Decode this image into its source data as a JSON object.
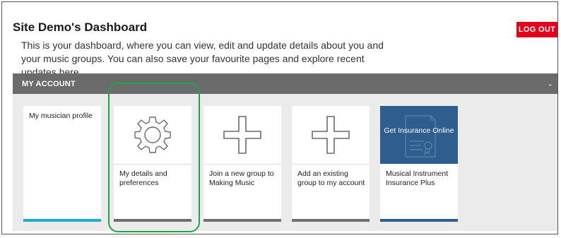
{
  "header": {
    "title": "Site Demo's Dashboard",
    "intro": "This is your dashboard, where you can view, edit and update details about you and your music groups. You can also save your favourite pages and explore recent updates here.",
    "logout_label": "LOG OUT"
  },
  "section": {
    "title": "MY ACCOUNT",
    "toggle": "-"
  },
  "tiles": [
    {
      "label": "My musician profile",
      "icon": "none",
      "accent": "#1eaad2"
    },
    {
      "label": "My details and preferences",
      "icon": "gear-icon",
      "accent": "#6f6f6f"
    },
    {
      "label": "Join a new group to Making Music",
      "icon": "plus-icon",
      "accent": "#6f6f6f"
    },
    {
      "label": "Add an existing group to my account",
      "icon": "plus-icon",
      "accent": "#6f6f6f"
    },
    {
      "label": "Musical Instrument Insurance Plus",
      "icon": "certificate-icon",
      "accent": "#2e5e8d",
      "promo_text": "Get Insurance Online"
    }
  ],
  "colors": {
    "logout": "#e0001b",
    "section_bar": "#6b6b6b",
    "highlight": "#22a34a",
    "insurance_bg": "#2e5e8d"
  }
}
